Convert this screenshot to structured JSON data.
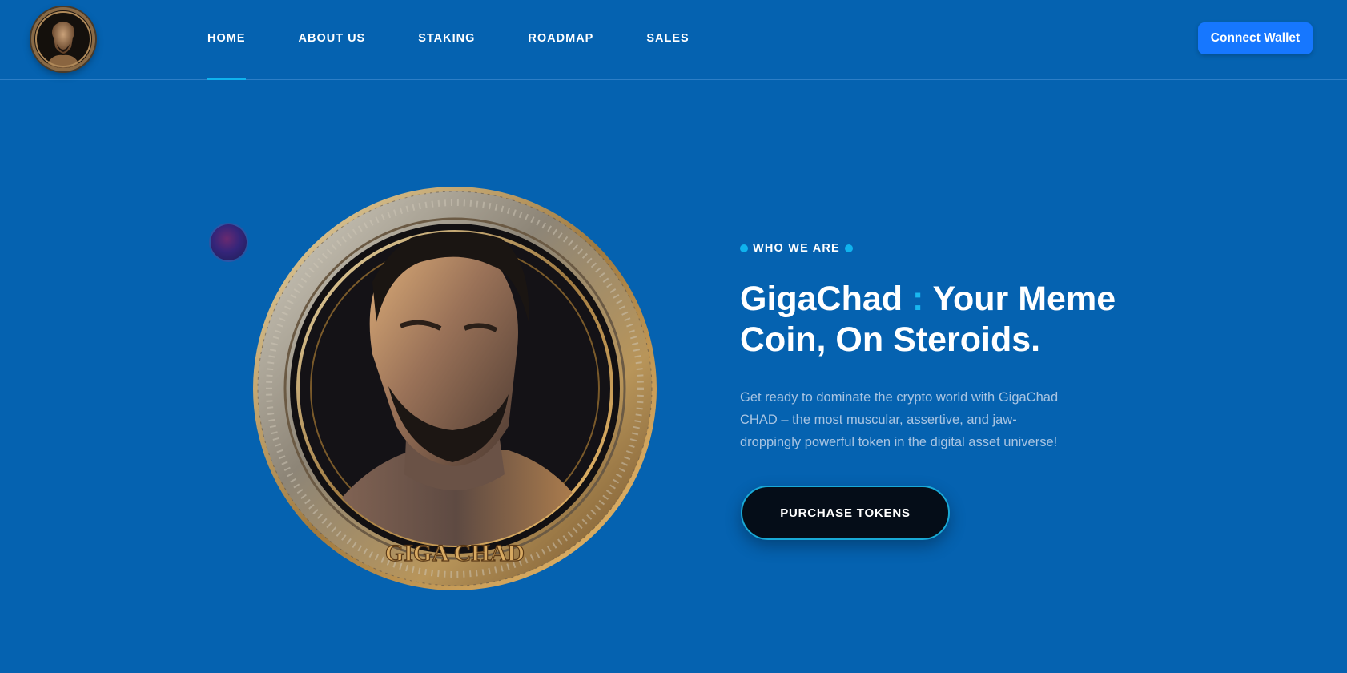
{
  "header": {
    "logo_icon": "gigachad-coin-logo-icon",
    "nav": [
      {
        "label": "HOME",
        "active": true
      },
      {
        "label": "ABOUT US",
        "active": false
      },
      {
        "label": "STAKING",
        "active": false
      },
      {
        "label": "ROADMAP",
        "active": false
      },
      {
        "label": "SALES",
        "active": false
      }
    ],
    "connect_label": "Connect Wallet"
  },
  "hero": {
    "coin_icon": "gigachad-coin-illustration-icon",
    "coin_caption": "GIGA CHAD",
    "eyebrow": "WHO WE ARE",
    "headline_brand": "GigaChad",
    "headline_sep": ":",
    "headline_rest": "Your Meme Coin, On Steroids.",
    "description": "Get ready to dominate the crypto world with GigaChad CHAD – the most muscular, assertive, and jaw-droppingly powerful token in the digital asset universe!",
    "cta_label": "PURCHASE TOKENS"
  },
  "colors": {
    "background": "#0562b0",
    "accent": "#0fb3ee",
    "button_blue": "#1677ff",
    "cta_background": "#050d18"
  }
}
